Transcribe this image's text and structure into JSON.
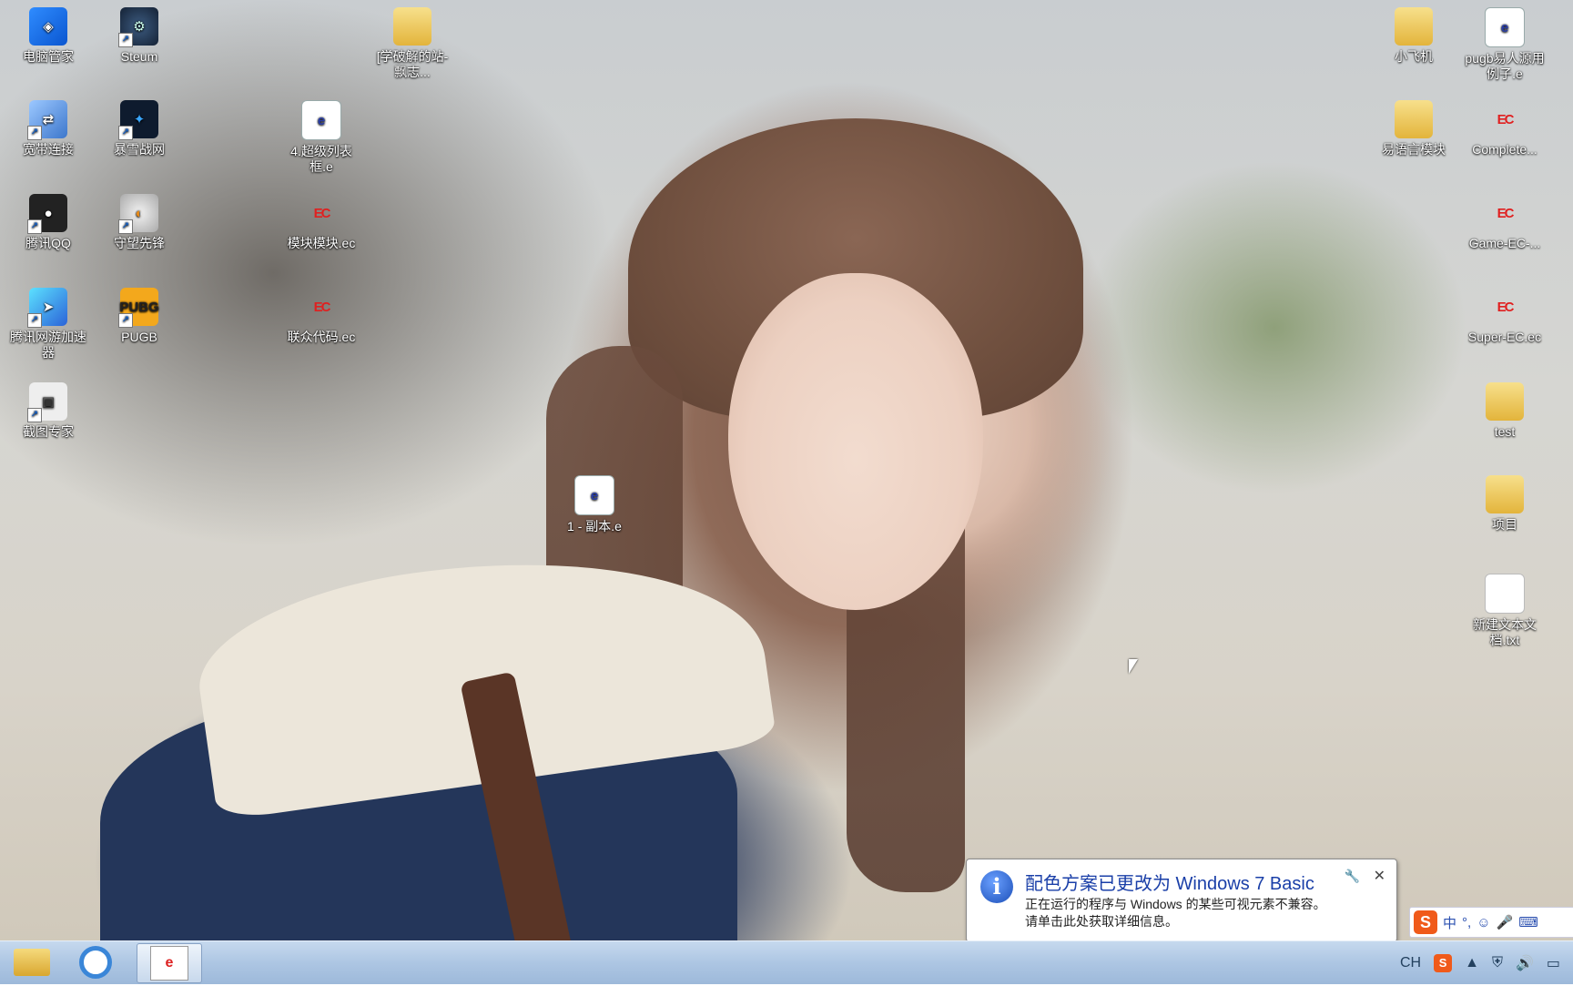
{
  "desktop": {
    "icons": [
      {
        "label": "电脑管家",
        "glyph": "◈"
      },
      {
        "label": "Steum",
        "glyph": "⚙"
      },
      {
        "label": "宽带连接",
        "glyph": "⇄"
      },
      {
        "label": "暴雪战网",
        "glyph": "✦"
      },
      {
        "label": "腾讯QQ",
        "glyph": "●"
      },
      {
        "label": "守望先锋",
        "glyph": "◐"
      },
      {
        "label": "腾讯网游加速器",
        "glyph": "➤"
      },
      {
        "label": "PUGB",
        "glyph": "PUBG"
      },
      {
        "label": "截图专家",
        "glyph": "▣"
      },
      {
        "label": "[学破解的站-飘志...",
        "glyph": ""
      },
      {
        "label": "4.超级列表框.e",
        "glyph": "e"
      },
      {
        "label": "模块模块.ec",
        "glyph": "EC"
      },
      {
        "label": "联众代码.ec",
        "glyph": "EC"
      },
      {
        "label": "1 - 副本.e",
        "glyph": "e"
      },
      {
        "label": "小飞机",
        "glyph": ""
      },
      {
        "label": "pugb易人源用例子.e",
        "glyph": "e"
      },
      {
        "label": "易语言模块",
        "glyph": ""
      },
      {
        "label": "Complete...",
        "glyph": "EC"
      },
      {
        "label": "Game-EC-...",
        "glyph": "EC"
      },
      {
        "label": "Super-EC.ec",
        "glyph": "EC"
      },
      {
        "label": "test",
        "glyph": ""
      },
      {
        "label": "项目",
        "glyph": ""
      },
      {
        "label": "新建文本文档.txt",
        "glyph": ""
      }
    ]
  },
  "notification": {
    "title": "配色方案已更改为 Windows 7 Basic",
    "line1": "正在运行的程序与 Windows 的某些可视元素不兼容。",
    "line2": "请单击此处获取详细信息。",
    "info_icon": "i",
    "wrench_icon": "🔧",
    "close_icon": "✕"
  },
  "ime": {
    "logo": "S",
    "mode": "中",
    "punct": "°,",
    "emoji": "☺",
    "mic": "🎤",
    "keyboard": "⌨"
  },
  "taskbar": {
    "apps": [
      "explorer",
      "ie",
      "easy-language"
    ],
    "app_e_label": "e",
    "tray": {
      "ch": "CH",
      "sogou": "S",
      "arrow": "▲",
      "shield": "⛨",
      "volume": "🔊",
      "network": "▭"
    }
  }
}
